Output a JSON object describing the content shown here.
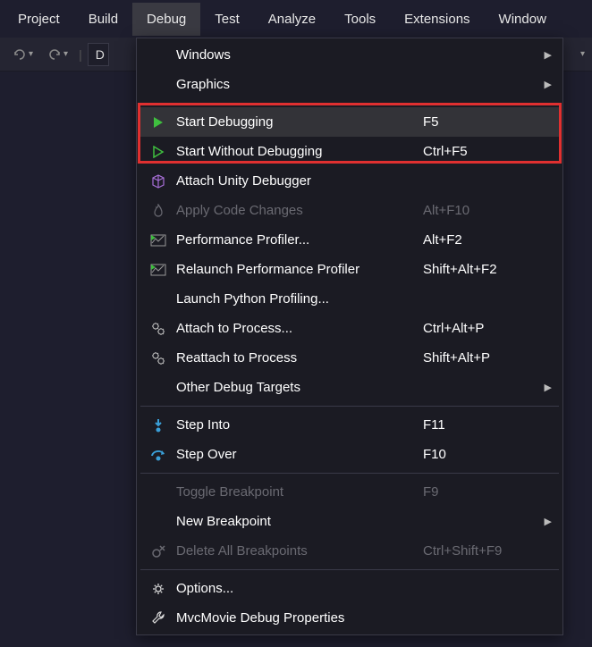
{
  "menubar": {
    "items": [
      {
        "label": "Project",
        "active": false
      },
      {
        "label": "Build",
        "active": false
      },
      {
        "label": "Debug",
        "active": true
      },
      {
        "label": "Test",
        "active": false
      },
      {
        "label": "Analyze",
        "active": false
      },
      {
        "label": "Tools",
        "active": false
      },
      {
        "label": "Extensions",
        "active": false
      },
      {
        "label": "Window",
        "active": false
      }
    ]
  },
  "toolbar": {
    "config_letter": "D"
  },
  "menu": {
    "items": [
      {
        "icon": "",
        "label": "Windows",
        "shortcut": "",
        "sub": true,
        "disabled": false
      },
      {
        "icon": "",
        "label": "Graphics",
        "shortcut": "",
        "sub": true,
        "disabled": false
      },
      {
        "sep": true
      },
      {
        "icon": "play-green-fill",
        "label": "Start Debugging",
        "shortcut": "F5",
        "sub": false,
        "disabled": false,
        "hover": true
      },
      {
        "icon": "play-green-outline",
        "label": "Start Without Debugging",
        "shortcut": "Ctrl+F5",
        "sub": false,
        "disabled": false
      },
      {
        "icon": "cube-purple",
        "label": "Attach Unity Debugger",
        "shortcut": "",
        "sub": false,
        "disabled": false
      },
      {
        "icon": "flame-grey",
        "label": "Apply Code Changes",
        "shortcut": "Alt+F10",
        "sub": false,
        "disabled": true
      },
      {
        "icon": "perf-green",
        "label": "Performance Profiler...",
        "shortcut": "Alt+F2",
        "sub": false,
        "disabled": false
      },
      {
        "icon": "perf-green",
        "label": "Relaunch Performance Profiler",
        "shortcut": "Shift+Alt+F2",
        "sub": false,
        "disabled": false
      },
      {
        "icon": "",
        "label": "Launch Python Profiling...",
        "shortcut": "",
        "sub": false,
        "disabled": false
      },
      {
        "icon": "gear-grey",
        "label": "Attach to Process...",
        "shortcut": "Ctrl+Alt+P",
        "sub": false,
        "disabled": false
      },
      {
        "icon": "gear-grey",
        "label": "Reattach to Process",
        "shortcut": "Shift+Alt+P",
        "sub": false,
        "disabled": false
      },
      {
        "icon": "",
        "label": "Other Debug Targets",
        "shortcut": "",
        "sub": true,
        "disabled": false
      },
      {
        "sep": true
      },
      {
        "icon": "step-into",
        "label": "Step Into",
        "shortcut": "F11",
        "sub": false,
        "disabled": false
      },
      {
        "icon": "step-over",
        "label": "Step Over",
        "shortcut": "F10",
        "sub": false,
        "disabled": false
      },
      {
        "sep": true
      },
      {
        "icon": "",
        "label": "Toggle Breakpoint",
        "shortcut": "F9",
        "sub": false,
        "disabled": true
      },
      {
        "icon": "",
        "label": "New Breakpoint",
        "shortcut": "",
        "sub": true,
        "disabled": false
      },
      {
        "icon": "bp-delete-grey",
        "label": "Delete All Breakpoints",
        "shortcut": "Ctrl+Shift+F9",
        "sub": false,
        "disabled": true
      },
      {
        "sep": true
      },
      {
        "icon": "options-gear",
        "label": "Options...",
        "shortcut": "",
        "sub": false,
        "disabled": false
      },
      {
        "icon": "wrench",
        "label": "MvcMovie Debug Properties",
        "shortcut": "",
        "sub": false,
        "disabled": false
      }
    ]
  },
  "colors": {
    "accent_green": "#3fbf3f",
    "accent_blue": "#3a9fd8",
    "accent_purple": "#a86fd8",
    "highlight_red": "#e03030"
  }
}
